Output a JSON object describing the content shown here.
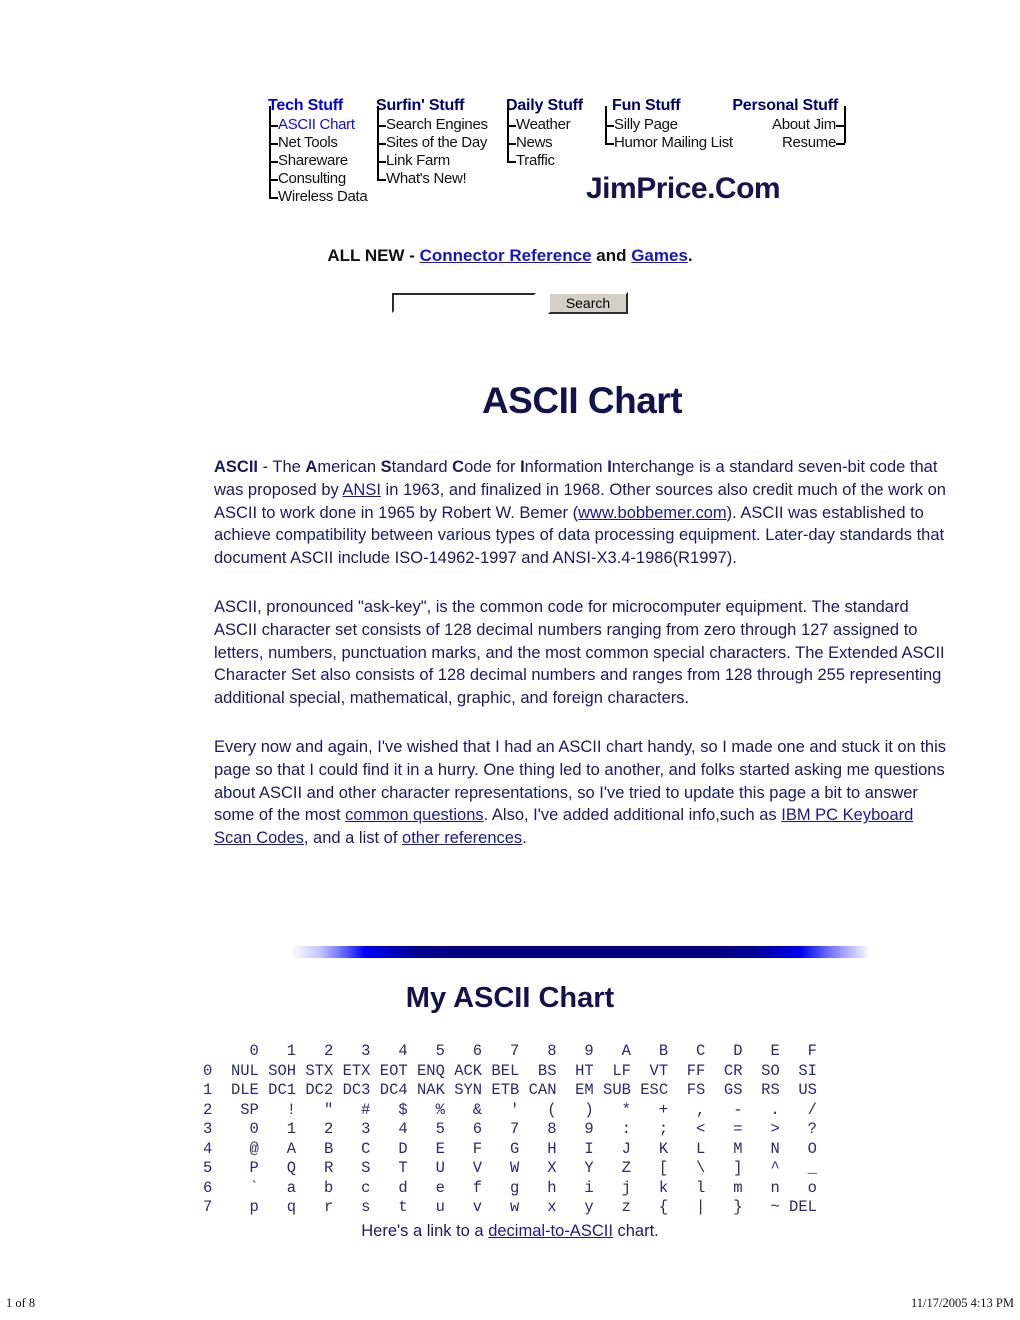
{
  "masthead": {
    "logo": "JimPrice.Com",
    "columns": [
      {
        "heading": "Tech Stuff",
        "heading_style": "link",
        "items": [
          {
            "label": "ASCII Chart",
            "current": true
          },
          {
            "label": "Net Tools",
            "current": false
          },
          {
            "label": "Shareware",
            "current": false
          },
          {
            "label": "Consulting",
            "current": false
          },
          {
            "label": "Wireless Data",
            "current": false
          }
        ]
      },
      {
        "heading": "Surfin' Stuff",
        "heading_style": "plain",
        "items": [
          {
            "label": "Search Engines",
            "current": false
          },
          {
            "label": "Sites of the Day",
            "current": false
          },
          {
            "label": "Link Farm",
            "current": false
          },
          {
            "label": "What's New!",
            "current": false
          }
        ]
      },
      {
        "heading": "Daily Stuff",
        "heading_style": "plain",
        "items": [
          {
            "label": "Weather",
            "current": false
          },
          {
            "label": "News",
            "current": false
          },
          {
            "label": "Traffic",
            "current": false
          }
        ]
      },
      {
        "heading": "Fun Stuff",
        "heading_style": "plain",
        "items": [
          {
            "label": "Silly Page",
            "current": false
          },
          {
            "label": "Humor Mailing List",
            "current": false
          }
        ]
      },
      {
        "heading": "Personal Stuff",
        "heading_style": "plain",
        "items": [
          {
            "label": "About Jim",
            "current": false
          },
          {
            "label": "Resume",
            "current": false
          }
        ]
      }
    ]
  },
  "announce": {
    "prefix": "ALL NEW - ",
    "link1": "Connector Reference",
    "middle": " and ",
    "link2": "Games",
    "suffix": "."
  },
  "search": {
    "value": "",
    "placeholder": "",
    "button_label": "Search"
  },
  "page_title": "ASCII Chart",
  "paragraphs": {
    "p1": {
      "seg1_bold": "ASCII",
      "seg2": " - The ",
      "a_bold": "A",
      "seg3": "merican ",
      "s_bold": "S",
      "seg4": "tandard ",
      "c_bold": "C",
      "seg5": "ode for ",
      "i1_bold": "I",
      "seg6": "nformation ",
      "i2_bold": "I",
      "seg7": "nterchange is a standard seven-bit code that was proposed by ",
      "link_ansi": "ANSI",
      "seg8": " in 1963, and finalized in 1968. Other sources also credit much of the work on ASCII to work done in 1965 by Robert W. Bemer (",
      "link_bobbemer": "www.bobbemer.com",
      "seg9": "). ASCII was established to achieve compatibility between various types of data processing equipment. Later-day standards that document ASCII include ISO-14962-1997 and ANSI-X3.4-1986(R1997)."
    },
    "p2": "ASCII, pronounced \"ask-key\", is the common code for microcomputer equipment. The standard ASCII character set consists of 128 decimal numbers ranging from zero through 127 assigned to letters, numbers, punctuation marks, and the most common special characters. The Extended ASCII Character Set also consists of 128 decimal numbers and ranges from 128 through 255 representing additional special, mathematical, graphic, and foreign characters.",
    "p3": {
      "seg1": "Every now and again, I've wished that I had an ASCII chart handy, so I made one and stuck it on this page so that I could find it in a hurry. One thing led to another, and folks started asking me questions about ASCII and other character representations, so I've tried to update this page a bit to answer some of the most ",
      "link_common": "common questions",
      "seg2": ". Also, I've added additional info,such as ",
      "link_ibm": "IBM PC Keyboard Scan Codes",
      "seg3": ", and a list of ",
      "link_other": "other references",
      "seg4": "."
    }
  },
  "chart_title": "My ASCII Chart",
  "chart_data": {
    "type": "table",
    "title": "My ASCII Chart",
    "column_headers": [
      "0",
      "1",
      "2",
      "3",
      "4",
      "5",
      "6",
      "7",
      "8",
      "9",
      "A",
      "B",
      "C",
      "D",
      "E",
      "F"
    ],
    "row_headers": [
      "0",
      "1",
      "2",
      "3",
      "4",
      "5",
      "6",
      "7"
    ],
    "rows": [
      [
        "NUL",
        "SOH",
        "STX",
        "ETX",
        "EOT",
        "ENQ",
        "ACK",
        "BEL",
        "BS",
        "HT",
        "LF",
        "VT",
        "FF",
        "CR",
        "SO",
        "SI"
      ],
      [
        "DLE",
        "DC1",
        "DC2",
        "DC3",
        "DC4",
        "NAK",
        "SYN",
        "ETB",
        "CAN",
        "EM",
        "SUB",
        "ESC",
        "FS",
        "GS",
        "RS",
        "US"
      ],
      [
        "SP",
        "!",
        "\"",
        "#",
        "$",
        "%",
        "&",
        "'",
        "(",
        ")",
        "*",
        "+",
        ",",
        "-",
        ".",
        "/"
      ],
      [
        "0",
        "1",
        "2",
        "3",
        "4",
        "5",
        "6",
        "7",
        "8",
        "9",
        ":",
        ";",
        "<",
        "=",
        ">",
        "?"
      ],
      [
        "@",
        "A",
        "B",
        "C",
        "D",
        "E",
        "F",
        "G",
        "H",
        "I",
        "J",
        "K",
        "L",
        "M",
        "N",
        "O"
      ],
      [
        "P",
        "Q",
        "R",
        "S",
        "T",
        "U",
        "V",
        "W",
        "X",
        "Y",
        "Z",
        "[",
        "\\",
        "]",
        "^",
        "_"
      ],
      [
        "`",
        "a",
        "b",
        "c",
        "d",
        "e",
        "f",
        "g",
        "h",
        "i",
        "j",
        "k",
        "l",
        "m",
        "n",
        "o"
      ],
      [
        "p",
        "q",
        "r",
        "s",
        "t",
        "u",
        "v",
        "w",
        "x",
        "y",
        "z",
        "{",
        "|",
        "}",
        "~",
        "DEL"
      ]
    ]
  },
  "bottom_link": {
    "prefix": "Here's a link to a ",
    "link": "decimal-to-ASCII",
    "suffix": " chart."
  },
  "print_footer": {
    "page": "1 of 8",
    "timestamp": "11/17/2005 4:13 PM"
  }
}
